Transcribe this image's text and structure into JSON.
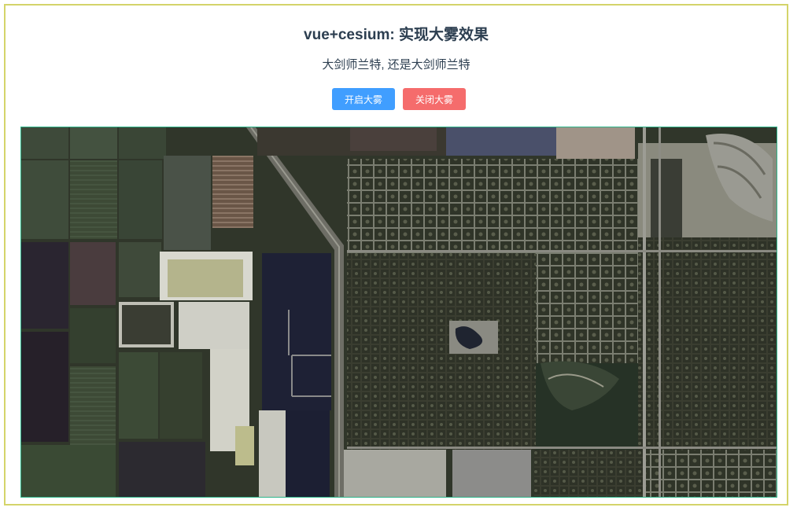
{
  "page": {
    "title": "vue+cesium: 实现大雾效果",
    "subtitle": "大剑师兰特, 还是大剑师兰特"
  },
  "controls": {
    "open_fog_label": "开启大雾",
    "close_fog_label": "关闭大雾"
  },
  "colors": {
    "open_button": "#409eff",
    "close_button": "#f56c6c",
    "outer_border": "#d4d46a",
    "viewer_border": "#2db58a",
    "title_text": "#2c3e50"
  },
  "map": {
    "type": "satellite-imagery"
  }
}
